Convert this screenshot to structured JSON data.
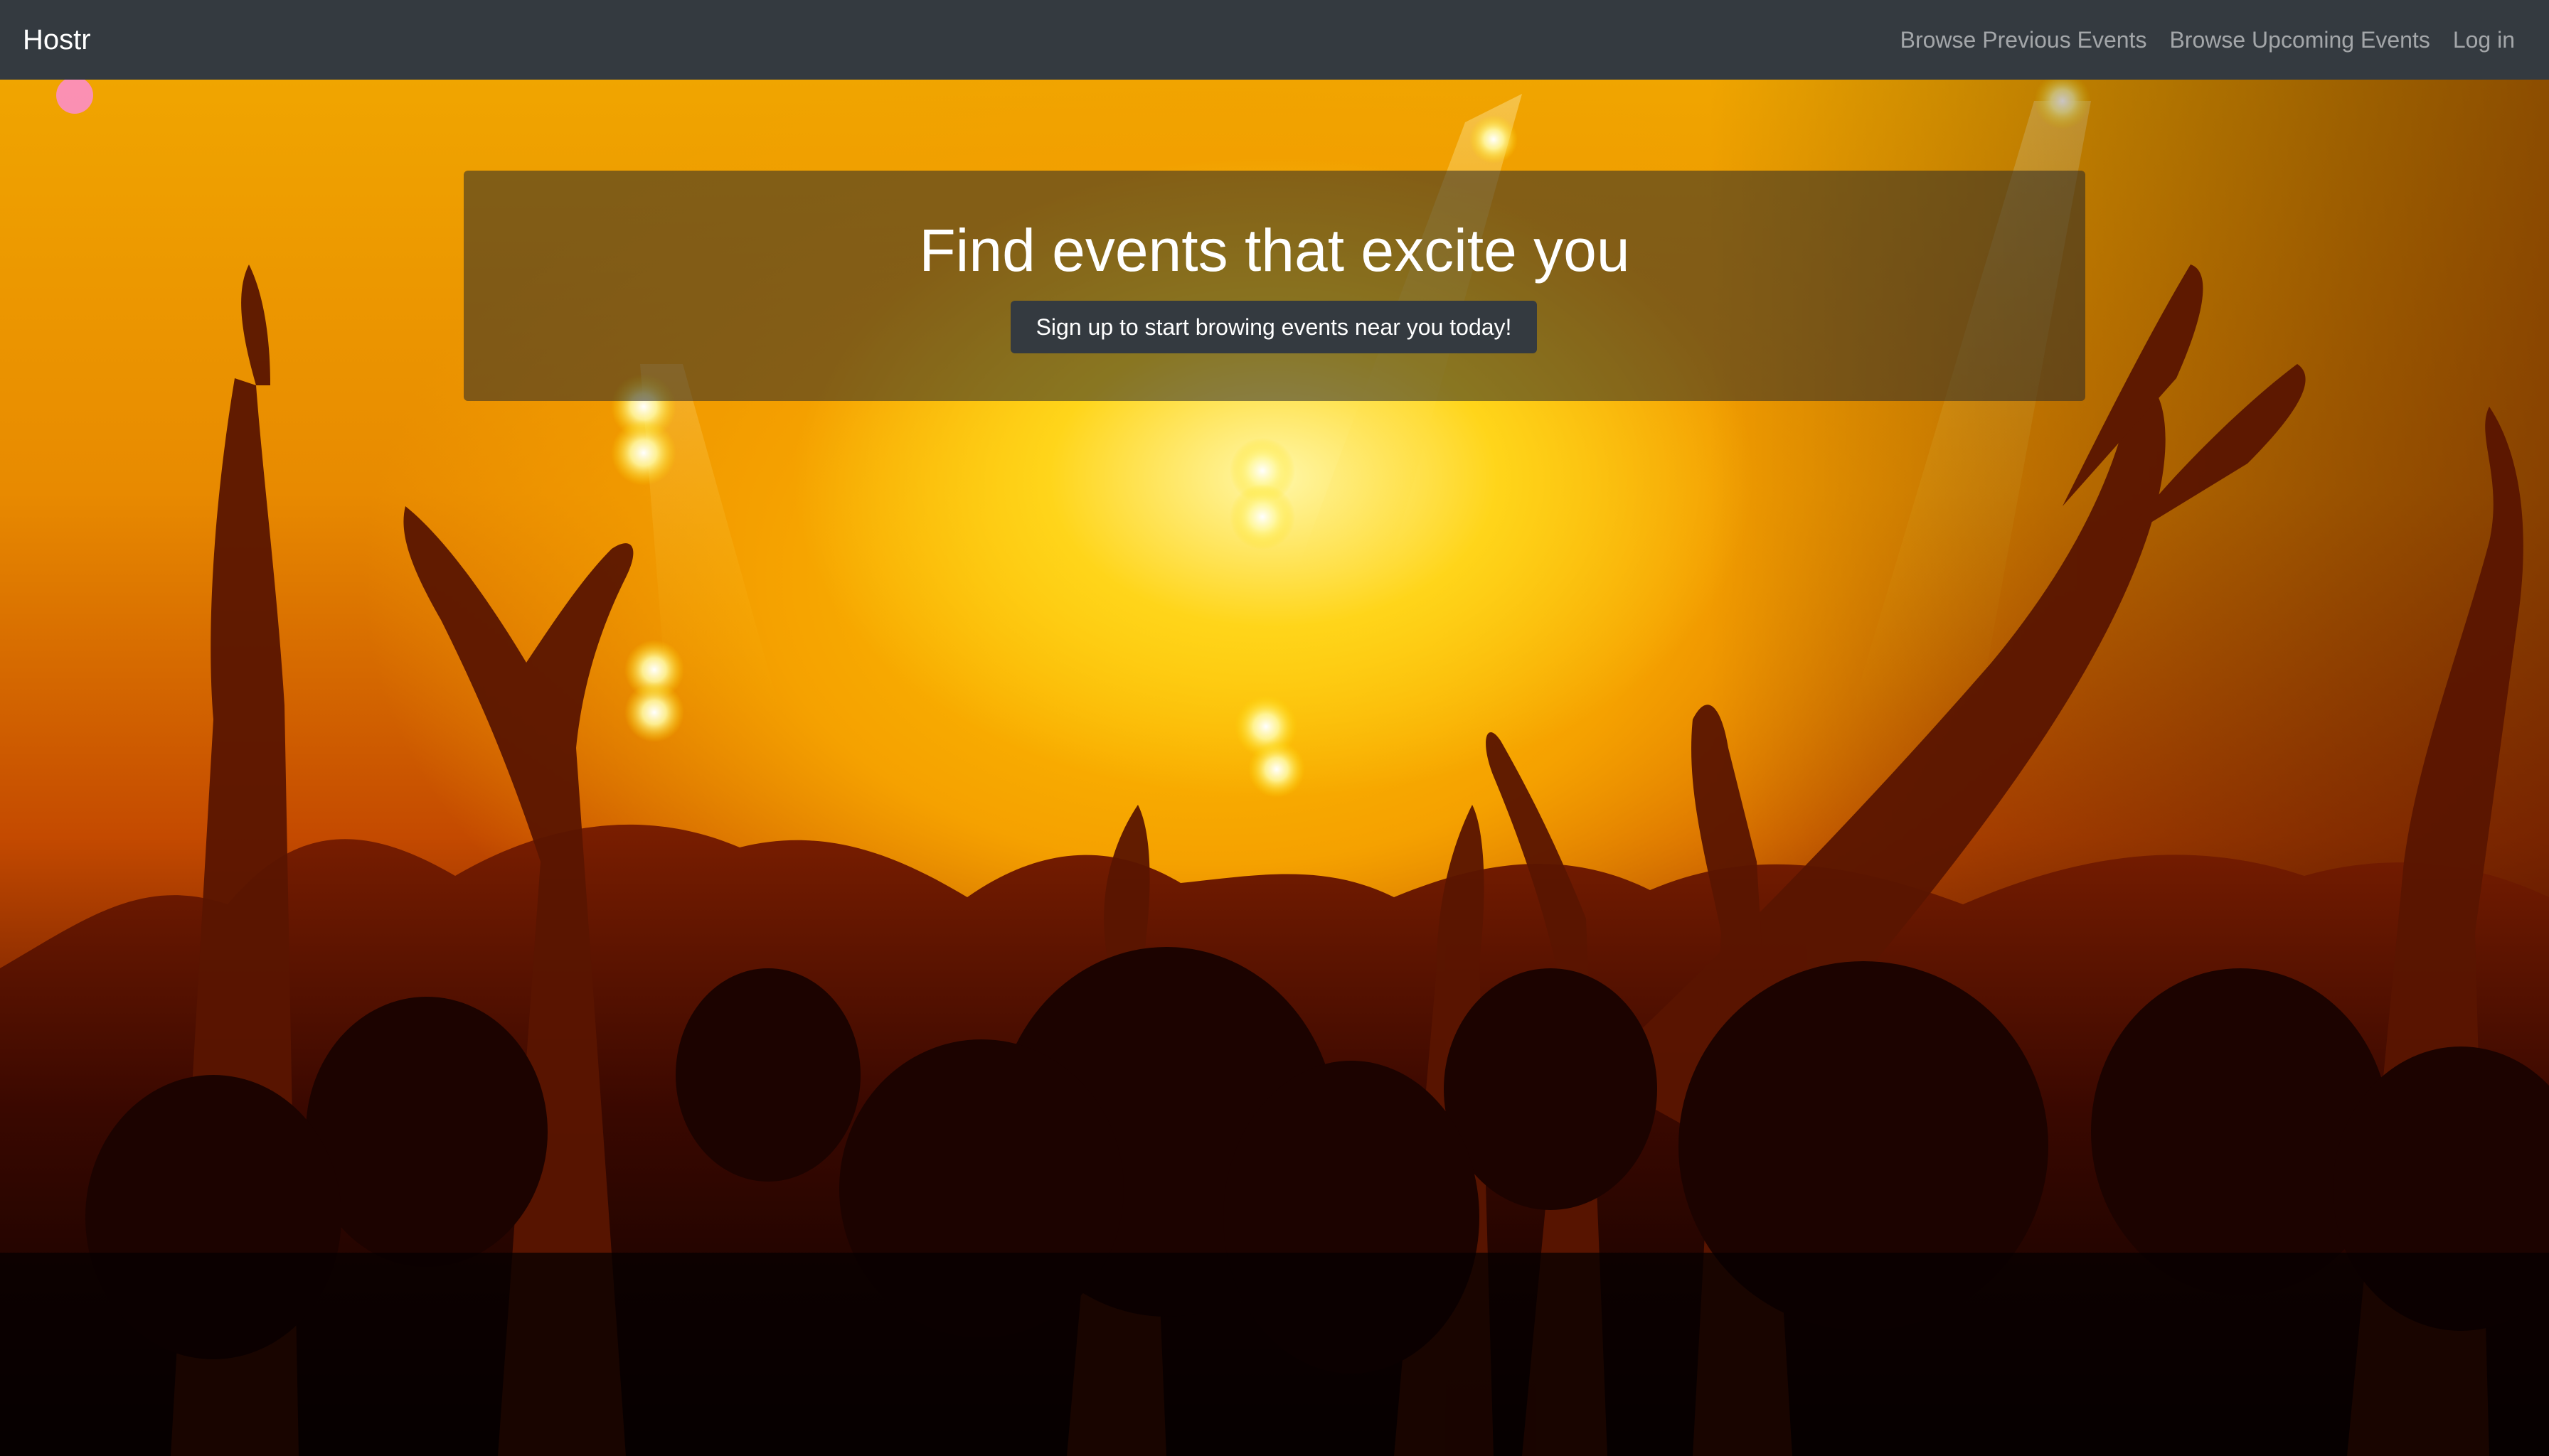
{
  "navbar": {
    "brand": "Hostr",
    "links": [
      {
        "label": "Browse Previous Events"
      },
      {
        "label": "Browse Upcoming Events"
      },
      {
        "label": "Log in"
      }
    ]
  },
  "hero": {
    "headline": "Find events that excite you",
    "cta_label": "Sign up to start browing events near you today!",
    "background_image": "concert-crowd-photo"
  },
  "colors": {
    "navbar": "#343a40",
    "nav_link": "rgba(255,255,255,0.55)",
    "button": "#343a40",
    "text": "#ffffff"
  }
}
